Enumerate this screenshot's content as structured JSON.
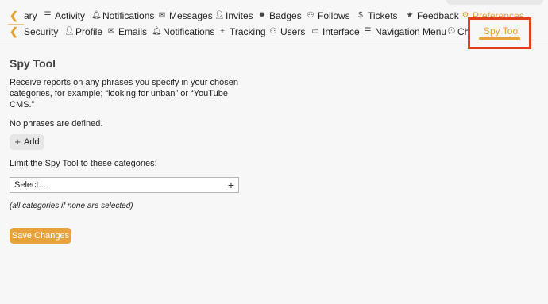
{
  "primary_nav": {
    "items": [
      {
        "label": "ary",
        "icon": "left-chevron-icon"
      },
      {
        "label": "Activity",
        "icon": "list-icon"
      },
      {
        "label": "Notifications",
        "icon": "bell-icon"
      },
      {
        "label": "Messages",
        "icon": "envelope-icon"
      },
      {
        "label": "Invites",
        "icon": "user-plus-icon"
      },
      {
        "label": "Badges",
        "icon": "certificate-icon"
      },
      {
        "label": "Follows",
        "icon": "users-icon"
      },
      {
        "label": "Tickets",
        "icon": "dollar-icon"
      },
      {
        "label": "Feedback",
        "icon": "star-icon"
      },
      {
        "label": "Preferences",
        "icon": "gear-icon",
        "active": true
      }
    ]
  },
  "secondary_nav": {
    "items": [
      {
        "label": "Security",
        "icon": "left-chevron-icon"
      },
      {
        "label": "Profile",
        "icon": "user-icon"
      },
      {
        "label": "Emails",
        "icon": "envelope-icon"
      },
      {
        "label": "Notifications",
        "icon": "bell-icon"
      },
      {
        "label": "Tracking",
        "icon": "plus-icon"
      },
      {
        "label": "Users",
        "icon": "users-icon"
      },
      {
        "label": "Interface",
        "icon": "desktop-icon"
      },
      {
        "label": "Navigation Menu",
        "icon": "bars-icon"
      },
      {
        "label": "Cha",
        "icon": "chat-icon"
      }
    ],
    "active_tab": "Spy Tool"
  },
  "main": {
    "title": "Spy Tool",
    "description": "Receive reports on any phrases you specify in your chosen categories, for example; “looking for unban” or “YouTube CMS.”",
    "empty_text": "No phrases are defined.",
    "add_label": "Add",
    "limit_label": "Limit the Spy Tool to these categories:",
    "select_value": "Select...",
    "hint": "(all categories if none are selected)",
    "save_label": "Save Changes"
  },
  "colors": {
    "accent": "#e8a23a",
    "highlight": "#e1401b"
  }
}
